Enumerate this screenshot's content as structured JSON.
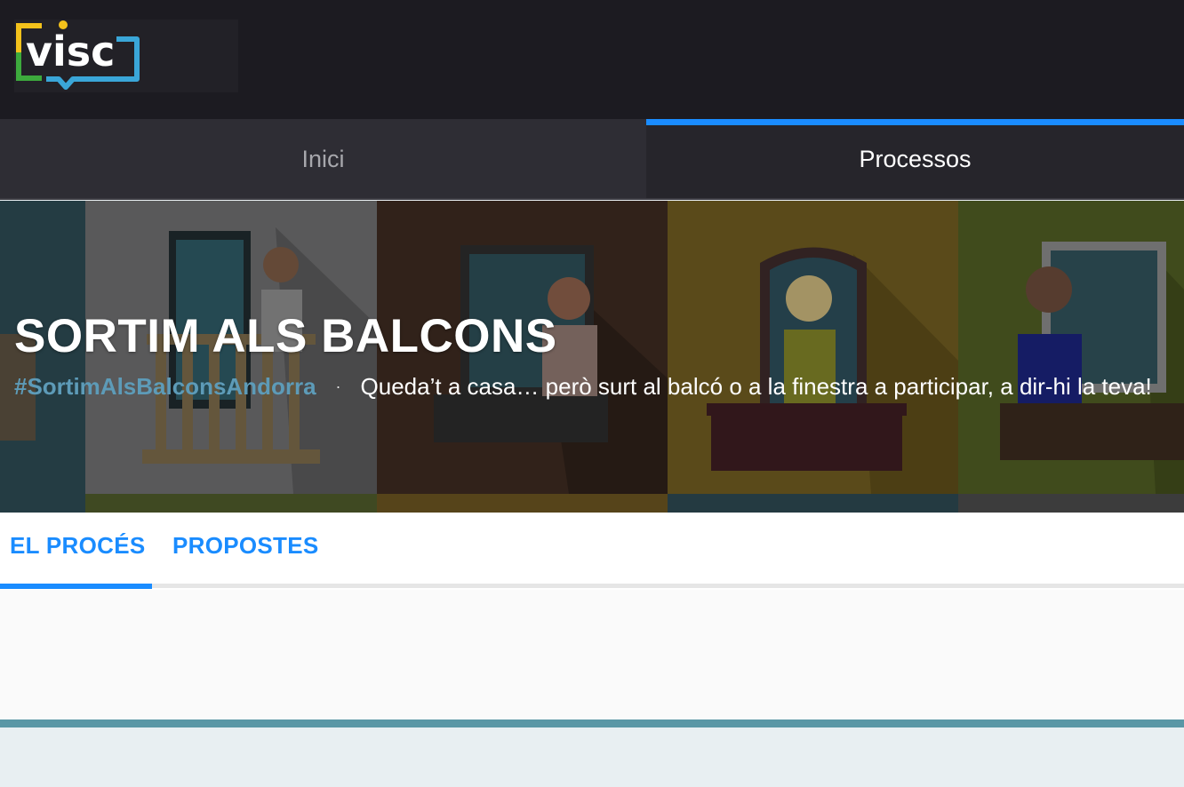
{
  "brand": {
    "logo_text": "visc"
  },
  "main_nav": {
    "tabs": [
      {
        "label": "Inici",
        "active": false
      },
      {
        "label": "Processos",
        "active": true
      }
    ]
  },
  "hero": {
    "title": "SORTIM ALS BALCONS",
    "hashtag": "#SortimAlsBalconsAndorra",
    "separator": "·",
    "description": "Queda’t a casa… però surt al balcó o a la finestra a participar, a dir-hi la teva!"
  },
  "process_nav": {
    "tabs": [
      {
        "label": "EL PROCÉS",
        "active": true
      },
      {
        "label": "PROPOSTES",
        "active": false
      }
    ]
  },
  "colors": {
    "accent": "#1a8cff",
    "topbar": "#1c1b21",
    "hashtag": "#5d9bb8"
  }
}
